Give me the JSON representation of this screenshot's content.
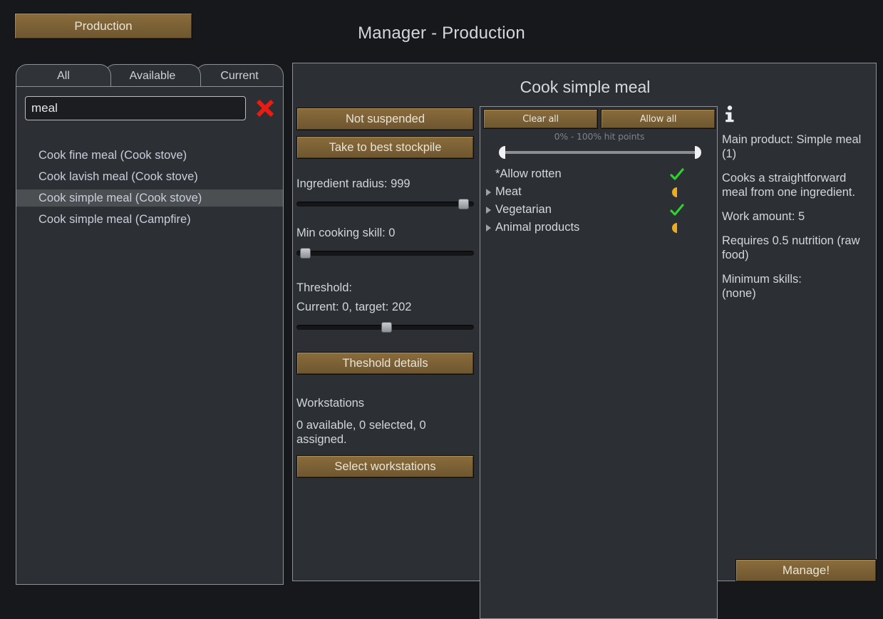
{
  "window": {
    "title": "Manager - Production",
    "production_tab_label": "Production"
  },
  "recipe_panel": {
    "tabs": [
      {
        "label": "All",
        "active": true
      },
      {
        "label": "Available",
        "active": false
      },
      {
        "label": "Current",
        "active": false
      }
    ],
    "search": {
      "value": "meal",
      "placeholder": "",
      "clear_icon": "red-x-icon"
    },
    "recipes": [
      {
        "label": "Cook fine meal (Cook stove)",
        "selected": false
      },
      {
        "label": "Cook lavish meal (Cook stove)",
        "selected": false
      },
      {
        "label": "Cook simple meal (Cook stove)",
        "selected": true
      },
      {
        "label": "Cook simple meal (Campfire)",
        "selected": false
      }
    ]
  },
  "main_panel": {
    "recipe_title": "Cook simple meal",
    "settings": {
      "suspend_button": "Not suspended",
      "stockpile_button": "Take to best stockpile",
      "ingredient_radius_label": "Ingredient radius: 999",
      "ingredient_radius_percent": 97,
      "min_skill_label": "Min cooking skill: 0",
      "min_skill_percent": 2,
      "threshold_heading": "Threshold:",
      "threshold_label": "Current: 0, target: 202",
      "threshold_percent": 51,
      "threshold_details_button": "Theshold details",
      "workstations_heading": "Workstations",
      "workstations_status": "0 available, 0 selected, 0 assigned.",
      "select_workstations_button": "Select workstations"
    },
    "filter": {
      "clear_all_button": "Clear all",
      "allow_all_button": "Allow all",
      "hit_points_label": "0% - 100% hit points",
      "rows": [
        {
          "label": "*Allow rotten",
          "state": "allowed",
          "expandable": false
        },
        {
          "label": "Meat",
          "state": "partial",
          "expandable": true
        },
        {
          "label": "Vegetarian",
          "state": "allowed",
          "expandable": true
        },
        {
          "label": "Animal products",
          "state": "partial",
          "expandable": true
        }
      ]
    },
    "info": {
      "icon": "info-icon",
      "paragraphs": [
        "Main product: Simple meal (1)",
        "Cooks a straightforward meal from one ingredient.",
        "Work amount: 5",
        "Requires 0.5 nutrition (raw food)",
        "Minimum skills:\n   (none)"
      ]
    }
  },
  "footer": {
    "manage_button": "Manage!"
  },
  "colors": {
    "background": "#16181b",
    "panel": "#2c2f33",
    "panel_border": "#8d9096",
    "button_brown": "#7d6236",
    "text": "#d4d7dc",
    "allowed_green": "#2fd02f",
    "partial_orange": "#edab1e",
    "clear_red": "#e81c13",
    "selected_row": "#4c4f52"
  }
}
